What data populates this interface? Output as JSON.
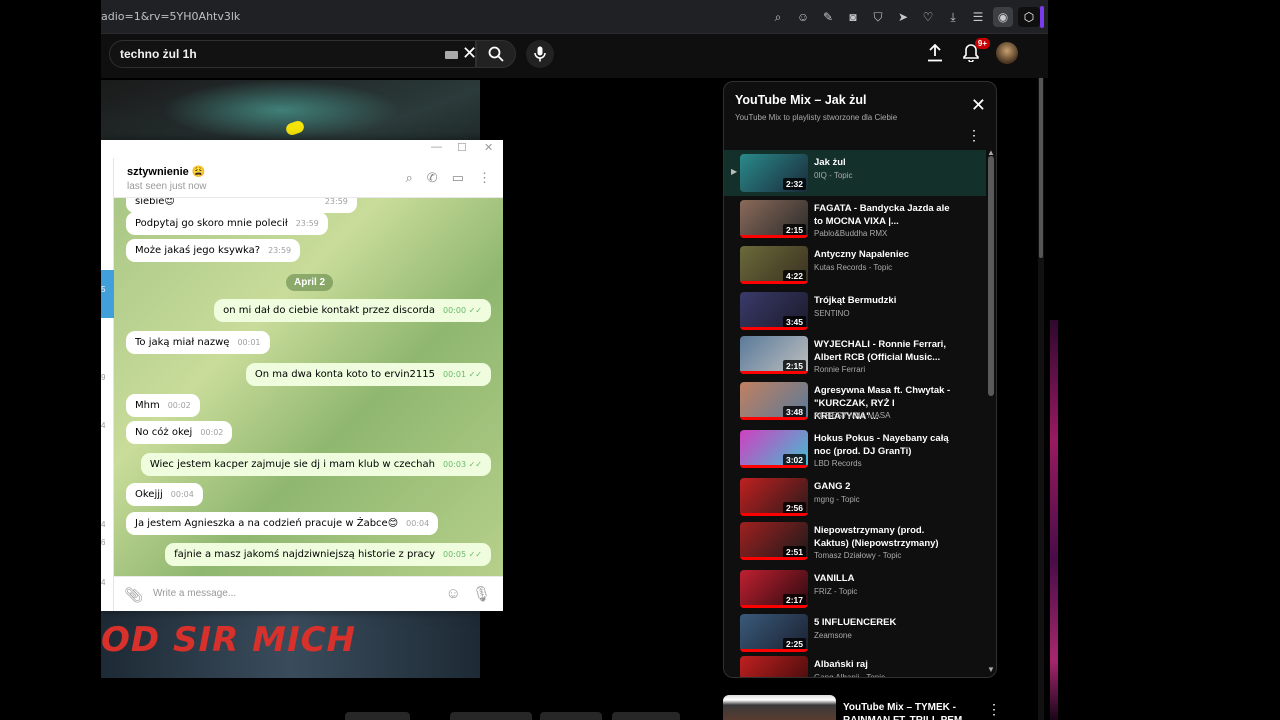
{
  "browser": {
    "url": "adio=1&rv=5YH0Ahtv3lk",
    "icons": [
      "zoom-icon",
      "emoji-icon",
      "edit-icon",
      "camera-icon",
      "shield-icon",
      "send-icon",
      "heart-icon",
      "download-icon",
      "menu-icon",
      "profile-icon",
      "extension-icon"
    ]
  },
  "youtube": {
    "search_value": "techno żul 1h",
    "notifications_badge": "9+"
  },
  "video": {
    "overlay_text": "OD SIR MICH"
  },
  "telegram": {
    "contact_name": "sztywnienie 😩",
    "status": "last seen just now",
    "left_counts": [
      "5",
      "9",
      "4",
      "4",
      "4",
      "6"
    ],
    "input_placeholder": "Write a message...",
    "top_partial": {
      "text": "siebie😊",
      "time": "23:59"
    },
    "date_separator": "April 2",
    "messages": [
      {
        "dir": "in",
        "text": "Podpytaj go skoro mnie polecił",
        "time": "23:59"
      },
      {
        "dir": "in",
        "text": "Może jakaś jego ksywka?",
        "time": "23:59"
      },
      {
        "dir": "out",
        "text": "on mi dał do ciebie kontakt przez discorda",
        "time": "00:00"
      },
      {
        "dir": "in",
        "text": "To jaką miał nazwę",
        "time": "00:01"
      },
      {
        "dir": "out",
        "text": "On ma dwa konta koto to ervin2115",
        "time": "00:01"
      },
      {
        "dir": "in",
        "text": "Mhm",
        "time": "00:02"
      },
      {
        "dir": "in",
        "text": "No cóż okej",
        "time": "00:02"
      },
      {
        "dir": "out",
        "text": "Wiec jestem kacper zajmuje sie dj  i  mam klub w czechah",
        "time": "00:03"
      },
      {
        "dir": "in",
        "text": "Okejjj",
        "time": "00:04"
      },
      {
        "dir": "in",
        "text": "Ja jestem Agnieszka a na codzień pracuje w Żabce😊",
        "time": "00:04"
      },
      {
        "dir": "out",
        "text": "fajnie a masz jakomś  najdziwniejszą historie z pracy",
        "time": "00:05"
      }
    ]
  },
  "mix": {
    "title": "YouTube Mix – Jak żul",
    "subtitle": "YouTube Mix to playlisty stworzone dla Ciebie",
    "items": [
      {
        "title": "Jak żul",
        "channel": "0IQ - Topic",
        "duration": "2:32",
        "current": true,
        "colors": [
          "#2a8a8a",
          "#1a2a3a"
        ]
      },
      {
        "title": "FAGATA - Bandycka Jazda ale to MOCNA VIXA |...",
        "channel": "Pablo&Buddha RMX",
        "duration": "2:15",
        "colors": [
          "#8a6a5a",
          "#2a2a2a"
        ]
      },
      {
        "title": "Antyczny Napaleniec",
        "channel": "Kutas Records - Topic",
        "duration": "4:22",
        "colors": [
          "#6a6a3a",
          "#3a3020"
        ]
      },
      {
        "title": "Trójkąt Bermudzki",
        "channel": "SENTINO",
        "duration": "3:45",
        "colors": [
          "#3a3a6a",
          "#1a1a2a"
        ]
      },
      {
        "title": "WYJECHALI - Ronnie Ferrari, Albert RCB (Official Music...",
        "channel": "Ronnie Ferrari",
        "duration": "2:15",
        "colors": [
          "#5a7a9a",
          "#c0c0c0"
        ]
      },
      {
        "title": "Agresywna Masa ft. Chwytak - \"KURCZAK, RYŻ I KREATYNA\"...",
        "channel": "AGRESYWNA MASA",
        "duration": "3:48",
        "colors": [
          "#c08060",
          "#5a7a9a"
        ]
      },
      {
        "title": "Hokus Pokus - Nayebany całą noc (prod. DJ GranTi)",
        "channel": "LBD Records",
        "duration": "3:02",
        "colors": [
          "#d040c0",
          "#40c0d0"
        ]
      },
      {
        "title": "GANG 2",
        "channel": "mgng - Topic",
        "duration": "2:56",
        "colors": [
          "#c02020",
          "#2a1a1a"
        ]
      },
      {
        "title": "Niepowstrzymany (prod. Kaktus) (Niepowstrzymany)",
        "channel": "Tomasz Działowy - Topic",
        "duration": "2:51",
        "colors": [
          "#a02020",
          "#1a1a1a"
        ]
      },
      {
        "title": "VANILLA",
        "channel": "FRIZ - Topic",
        "duration": "2:17",
        "colors": [
          "#c02030",
          "#2a0a10"
        ]
      },
      {
        "title": "5 INFLUENCEREK",
        "channel": "Zeamsone",
        "duration": "2:25",
        "colors": [
          "#3a5a7a",
          "#1a2030"
        ]
      },
      {
        "title": "Albański raj",
        "channel": "Gang Albanii - Topic",
        "duration": "",
        "colors": [
          "#c02020",
          "#3a0a0a"
        ]
      }
    ]
  },
  "suggestion": {
    "title": "YouTube Mix – TYMEK - RAINMAN FT. TRILL PEM, TE..."
  }
}
